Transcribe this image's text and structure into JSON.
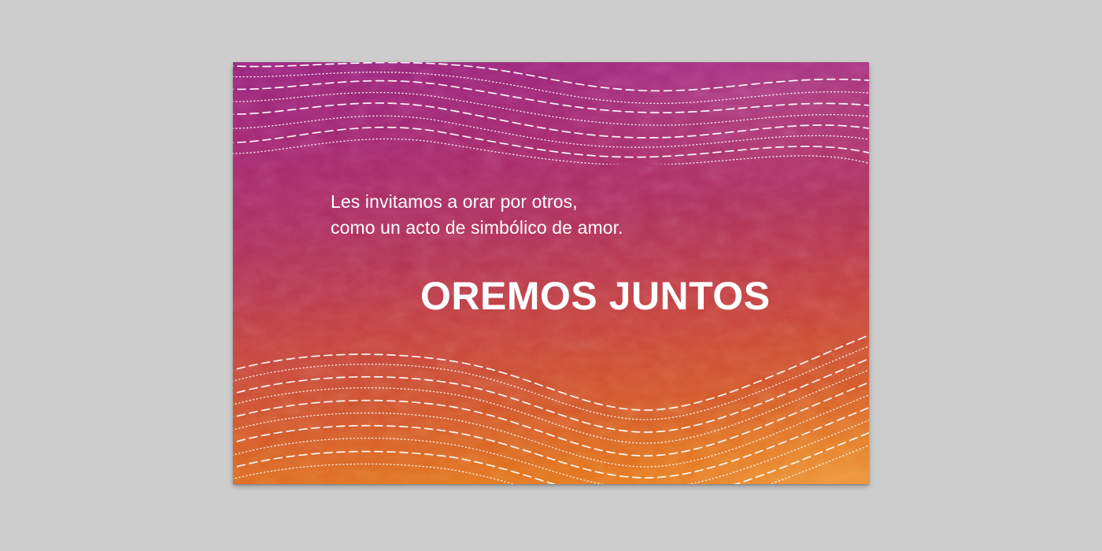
{
  "card": {
    "invitation_line_1": "Les invitamos a orar por otros,",
    "invitation_line_2": "como un acto de simbólico de amor.",
    "headline": "OREMOS JUNTOS"
  },
  "colors": {
    "background": "#cdcdcd",
    "gradient_top": "#9a2580",
    "gradient_middle": "#b2345a",
    "gradient_bottom": "#e8842a",
    "text": "#ffffff"
  },
  "decorations": {
    "top_band": "wavy dashed and dotted lines",
    "bottom_band": "wavy dashed and dotted lines"
  }
}
